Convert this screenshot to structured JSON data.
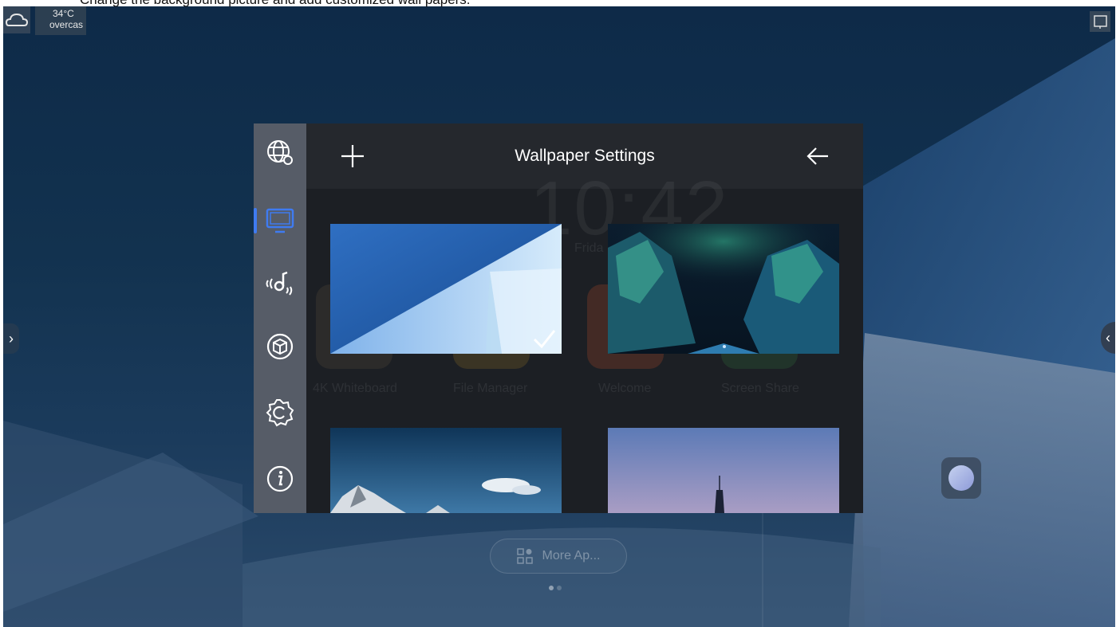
{
  "caption": "Change the background picture and add customized wall papers.",
  "weather": {
    "temperature": "34°C",
    "condition": "overcas",
    "icon": "cloud-icon"
  },
  "panel": {
    "title": "Wallpaper Settings",
    "add_icon": "plus-icon",
    "back_icon": "arrow-left-icon",
    "sidebar": [
      {
        "icon": "globe-settings-icon",
        "active": false
      },
      {
        "icon": "monitor-icon",
        "active": true
      },
      {
        "icon": "audio-wave-icon",
        "active": false
      },
      {
        "icon": "cube-icon",
        "active": false
      },
      {
        "icon": "gear-icon",
        "active": false
      },
      {
        "icon": "info-icon",
        "active": false
      }
    ],
    "wallpapers": [
      {
        "name": "blue-geometric",
        "selected": true
      },
      {
        "name": "aurora-mountains",
        "selected": false
      },
      {
        "name": "snow-mountains",
        "selected": false
      },
      {
        "name": "city-tower-dusk",
        "selected": false
      }
    ]
  },
  "background_home": {
    "clock": "10:42",
    "day": "Frida",
    "apps": [
      "4K Whiteboard",
      "File Manager",
      "Welcome",
      "Screen Share"
    ]
  },
  "more_apps_label": "More Ap...",
  "page_dots": 2,
  "colors": {
    "accent": "#3f7bf1",
    "sidebar": "#565c67",
    "panel": "#1f2227"
  }
}
